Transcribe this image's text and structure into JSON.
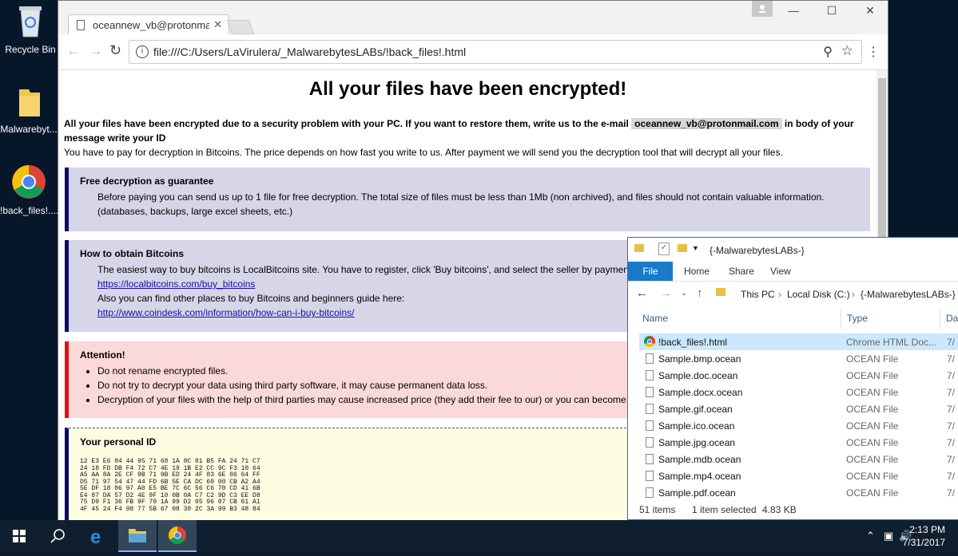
{
  "desktop": {
    "icons": [
      {
        "label": "Recycle Bin"
      },
      {
        "label": "Malwarebyt..."
      },
      {
        "label": "!back_files!...."
      }
    ]
  },
  "browser": {
    "tab_title": "oceannew_vb@protonmail.com",
    "url": "file:///C:/Users/LaVirulera/_MalwarebytesLABs/!back_files!.html"
  },
  "page": {
    "title": "All your files have been encrypted!",
    "intro_bold_1": "All your files have been encrypted due to a security problem with your PC. If you want to restore them, write us to the e-mail",
    "email": "oceannew_vb@protonmail.com",
    "intro_bold_2": "in body of your message write your ID",
    "intro_2": "You have to pay for decryption in Bitcoins. The price depends on how fast you write to us. After payment we will send you the decryption tool that will decrypt all your files.",
    "free_title": "Free decryption as guarantee",
    "free_text": "Before paying you can send us up to 1 file for free decryption. The total size of files must be less than 1Mb (non archived), and files should not contain valuable information. (databases, backups, large excel sheets, etc.)",
    "btc_title": "How to obtain Bitcoins",
    "btc_text_1": "The easiest way to buy bitcoins is LocalBitcoins site. You have to register, click 'Buy bitcoins', and select the seller by payment method",
    "btc_link_1": "https://localbitcoins.com/buy_bitcoins",
    "btc_text_2": "Also you can find other places to buy Bitcoins and beginners guide here:",
    "btc_link_2": "http://www.coindesk.com/information/how-can-i-buy-bitcoins/",
    "att_title": "Attention!",
    "att_1": "Do not rename encrypted files.",
    "att_2": "Do not try to decrypt your data using third party software, it may cause permanent data loss.",
    "att_3": "Decryption of your files with the help of third parties may cause increased price (they add their fee to our) or you can become a victim",
    "id_title": "Your personal ID",
    "id_hex": "12 E3 E6 04 44 95 71 68 1A 8C 81 B5 FA 24 71 C7\n24 18 FD DB F4 72 C7 4E 19 1B E2 CC 9C F3 10 64\nA5 AA 8A 2E CF 9B 71 9B ED 24 4F 83 6E 06 64 FF\nD5 71 97 54 47 44 FD 6B 5E CA DC 60 00 CB A2 A4\n5E DF 18 06 97 A0 E5 BE 7C 6C 56 C6 70 CD 41 6B\nE4 87 DA 57 D2 4E 9F 10 0B 0A C7 C2 9D C3 EE D8\n75 D9 F1 36 FB 9F 79 1A 99 D2 05 96 07 CB 61 A1\n4F 45 24 F4 98 77 5B 67 08 30 2C 3A 99 B3 48 84"
  },
  "explorer": {
    "title": "{-MalwarebytesLABs-}",
    "ribbon": {
      "file": "File",
      "home": "Home",
      "share": "Share",
      "view": "View"
    },
    "path": [
      "This PC",
      "Local Disk (C:)",
      "{-MalwarebytesLABs-}"
    ],
    "columns": {
      "name": "Name",
      "type": "Type",
      "date": "Da"
    },
    "rows": [
      {
        "name": "!back_files!.html",
        "type": "Chrome HTML Doc...",
        "date": "7/"
      },
      {
        "name": "Sample.bmp.ocean",
        "type": "OCEAN File",
        "date": "7/"
      },
      {
        "name": "Sample.doc.ocean",
        "type": "OCEAN File",
        "date": "7/"
      },
      {
        "name": "Sample.docx.ocean",
        "type": "OCEAN File",
        "date": "7/"
      },
      {
        "name": "Sample.gif.ocean",
        "type": "OCEAN File",
        "date": "7/"
      },
      {
        "name": "Sample.ico.ocean",
        "type": "OCEAN File",
        "date": "7/"
      },
      {
        "name": "Sample.jpg.ocean",
        "type": "OCEAN File",
        "date": "7/"
      },
      {
        "name": "Sample.mdb.ocean",
        "type": "OCEAN File",
        "date": "7/"
      },
      {
        "name": "Sample.mp4.ocean",
        "type": "OCEAN File",
        "date": "7/"
      },
      {
        "name": "Sample.pdf.ocean",
        "type": "OCEAN File",
        "date": "7/"
      }
    ],
    "status_items": "51 items",
    "status_selected": "1 item selected",
    "status_size": "4.83 KB"
  },
  "taskbar": {
    "time": "2:13 PM",
    "date": "7/31/2017"
  }
}
